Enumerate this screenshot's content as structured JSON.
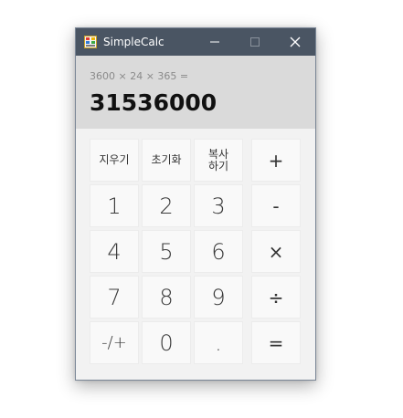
{
  "window": {
    "title": "SimpleCalc"
  },
  "titlebar": {
    "minimize_icon": "minimize-icon",
    "maximize_icon": "maximize-icon",
    "close_icon": "close-icon"
  },
  "display": {
    "expression": "3600 × 24 × 365 =",
    "result": "31536000"
  },
  "keys": {
    "clear": "지우기",
    "reset": "초기화",
    "copy": "복사\n하기",
    "plus": "+",
    "d1": "1",
    "d2": "2",
    "d3": "3",
    "minus": "-",
    "d4": "4",
    "d5": "5",
    "d6": "6",
    "multiply": "×",
    "d7": "7",
    "d8": "8",
    "d9": "9",
    "divide": "÷",
    "negate": "-/+",
    "d0": "0",
    "dot": ".",
    "equals": "="
  },
  "colors": {
    "titlebar": "#4a5563",
    "display_bg": "#dadada",
    "key_bg": "#f9f9f9",
    "body_bg": "#f2f2f2"
  }
}
